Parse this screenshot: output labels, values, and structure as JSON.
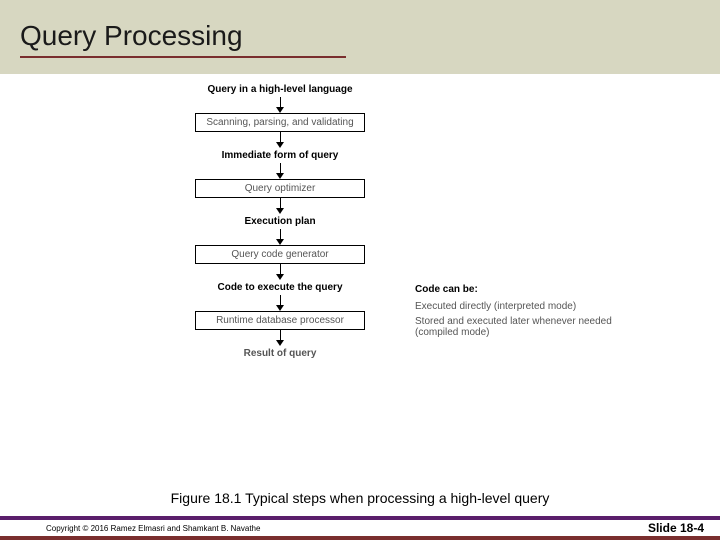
{
  "title": "Query Processing",
  "flow": {
    "step1_label": "Query in a high-level language",
    "box1": "Scanning, parsing, and validating",
    "step2_label": "Immediate form of query",
    "box2": "Query optimizer",
    "step3_label": "Execution plan",
    "box3": "Query code generator",
    "step4_label": "Code to execute the query",
    "box4": "Runtime database processor",
    "step5_label": "Result of query"
  },
  "side": {
    "head": "Code can be:",
    "line1": "Executed directly (interpreted mode)",
    "line2": "Stored and executed later whenever needed (compiled mode)"
  },
  "caption": "Figure 18.1 Typical steps when processing a high-level query",
  "copyright": "Copyright © 2016 Ramez Elmasri and Shamkant B. Navathe",
  "slidenum": "Slide 18-4"
}
